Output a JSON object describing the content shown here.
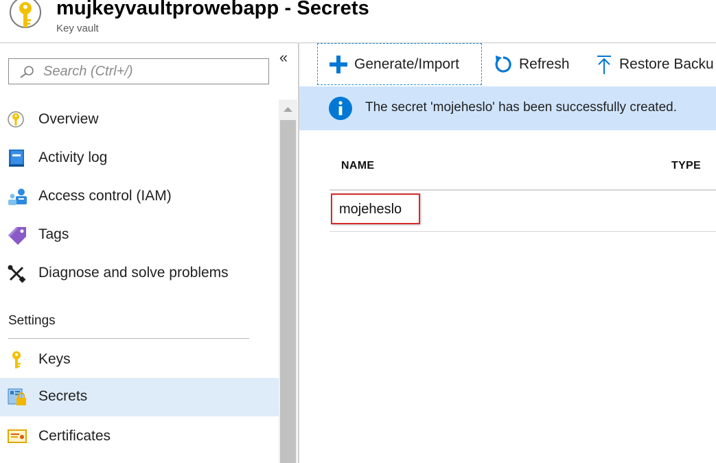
{
  "header": {
    "title": "mujkeyvaultprowebapp - Secrets",
    "subtitle": "Key vault",
    "logo_icon": "key-vault-icon"
  },
  "sidebar": {
    "collapse_label": "«",
    "search": {
      "placeholder": "Search (Ctrl+/)",
      "value": ""
    },
    "items": [
      {
        "label": "Overview",
        "icon": "key-vault-icon"
      },
      {
        "label": "Activity log",
        "icon": "book-icon"
      },
      {
        "label": "Access control (IAM)",
        "icon": "people-icon"
      },
      {
        "label": "Tags",
        "icon": "tag-icon"
      },
      {
        "label": "Diagnose and solve problems",
        "icon": "wrench-icon"
      }
    ],
    "section_settings": "Settings",
    "settings_items": [
      {
        "label": "Keys",
        "icon": "key-icon"
      },
      {
        "label": "Secrets",
        "icon": "secret-icon",
        "active": true
      },
      {
        "label": "Certificates",
        "icon": "certificate-icon"
      }
    ]
  },
  "toolbar": {
    "generate_label": "Generate/Import",
    "refresh_label": "Refresh",
    "restore_label": "Restore Backu"
  },
  "banner": {
    "message": "The secret 'mojeheslo' has been successfully created.",
    "icon": "info-icon"
  },
  "table": {
    "columns": [
      "NAME",
      "TYPE"
    ],
    "rows": [
      {
        "name": "mojeheslo",
        "type": ""
      }
    ]
  },
  "colors": {
    "accent": "#0078d4",
    "banner_bg": "#cfe4fa",
    "active_item_bg": "#deecf9",
    "highlight_border": "#d42b2b"
  }
}
